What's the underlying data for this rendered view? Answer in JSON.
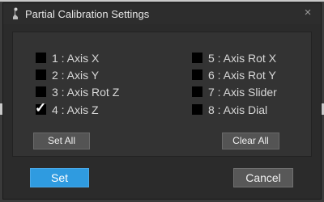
{
  "window": {
    "title": "Partial Calibration Settings",
    "close_symbol": "×"
  },
  "axes": [
    {
      "label": "1 : Axis X",
      "checked": false
    },
    {
      "label": "2 : Axis Y",
      "checked": false
    },
    {
      "label": "3 : Axis Rot Z",
      "checked": false
    },
    {
      "label": "4 : Axis Z",
      "checked": true
    },
    {
      "label": "5 : Axis Rot X",
      "checked": false
    },
    {
      "label": "6 : Axis Rot Y",
      "checked": false
    },
    {
      "label": "7 : Axis Slider",
      "checked": false
    },
    {
      "label": "8 : Axis Dial",
      "checked": false
    }
  ],
  "check_mark": "✓",
  "buttons": {
    "set_all": "Set All",
    "clear_all": "Clear All",
    "set": "Set",
    "cancel": "Cancel"
  },
  "colors": {
    "primary_button": "#2f9be0",
    "dialog_background": "#2b2b2b"
  }
}
